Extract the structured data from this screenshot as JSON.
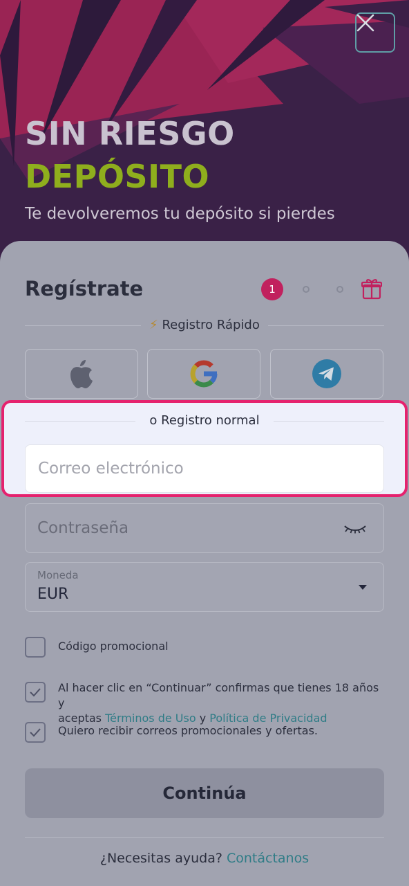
{
  "hero": {
    "title_line1": "SIN RIESGO",
    "title_line2": "DEPÓSITO",
    "subtitle": "Te devolveremos tu depósito si pierdes"
  },
  "form": {
    "title": "Regístrate",
    "step_current": "1",
    "quick_label": "Registro Rápido",
    "social": [
      "apple-icon",
      "google-icon",
      "telegram-icon"
    ],
    "normal_label": "o Registro normal",
    "email_placeholder": "Correo electrónico",
    "password_placeholder": "Contraseña",
    "currency_label": "Moneda",
    "currency_value": "EUR",
    "promo_label": "Código promocional",
    "terms_prefix": "Al hacer clic en “Continuar” confirmas que tienes 18 años y",
    "terms_accept": "aceptas",
    "terms_link": "Términos de Uso",
    "terms_and": "y",
    "privacy_link": "Política de Privacidad",
    "newsletter_label": "Quiero recibir correos promocionales y ofertas.",
    "continue_label": "Continúa",
    "help_text": "¿Necesitas ayuda?",
    "help_link": "Contáctanos"
  },
  "colors": {
    "accent_pink": "#e5226e",
    "lime": "#8fae1d",
    "link_teal": "#2f7c86"
  }
}
